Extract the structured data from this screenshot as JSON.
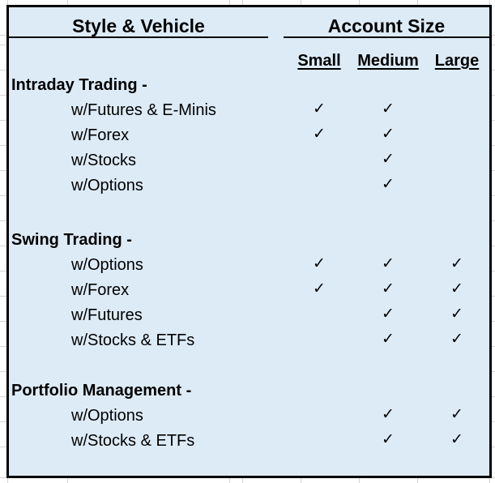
{
  "headers": {
    "left_title": "Style & Vehicle",
    "right_title": "Account Size"
  },
  "columns": [
    "Small",
    "Medium",
    "Large"
  ],
  "check_glyph": "✓",
  "sections": [
    {
      "title": "Intraday Trading -",
      "rows": [
        {
          "label": "w/Futures & E-Minis",
          "small": true,
          "medium": true,
          "large": false
        },
        {
          "label": "w/Forex",
          "small": true,
          "medium": true,
          "large": false
        },
        {
          "label": "w/Stocks",
          "small": false,
          "medium": true,
          "large": false
        },
        {
          "label": "w/Options",
          "small": false,
          "medium": true,
          "large": false
        }
      ]
    },
    {
      "title": "Swing Trading -",
      "rows": [
        {
          "label": "w/Options",
          "small": true,
          "medium": true,
          "large": true
        },
        {
          "label": "w/Forex",
          "small": true,
          "medium": true,
          "large": true
        },
        {
          "label": "w/Futures",
          "small": false,
          "medium": true,
          "large": true
        },
        {
          "label": "w/Stocks & ETFs",
          "small": false,
          "medium": true,
          "large": true
        }
      ]
    },
    {
      "title": "Portfolio Management -",
      "rows": [
        {
          "label": "w/Options",
          "small": false,
          "medium": true,
          "large": true
        },
        {
          "label": "w/Stocks & ETFs",
          "small": false,
          "medium": true,
          "large": true
        }
      ]
    }
  ],
  "colors": {
    "fill": "#ddebf7",
    "border": "#000000",
    "gridline": "#d4d4d4"
  }
}
